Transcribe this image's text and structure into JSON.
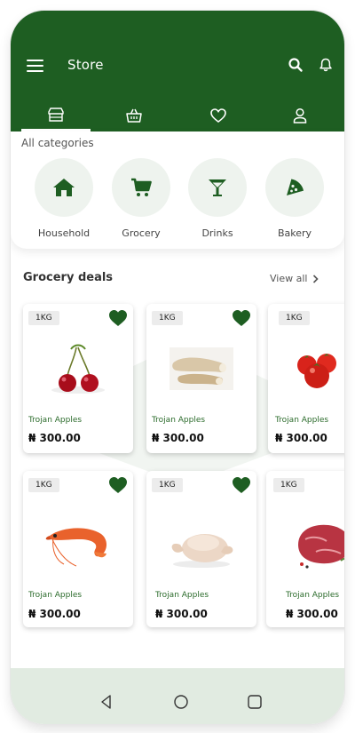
{
  "header": {
    "title": "Store"
  },
  "tabs": [
    {
      "name": "store"
    },
    {
      "name": "basket"
    },
    {
      "name": "favorites"
    },
    {
      "name": "profile"
    }
  ],
  "categories": {
    "heading": "All categories",
    "items": [
      {
        "label": "Household",
        "icon": "home-icon"
      },
      {
        "label": "Grocery",
        "icon": "cart-icon"
      },
      {
        "label": "Drinks",
        "icon": "cocktail-icon"
      },
      {
        "label": "Bakery",
        "icon": "pizza-icon"
      }
    ]
  },
  "deals": {
    "title": "Grocery deals",
    "view_all": "View all",
    "products": [
      {
        "qty": "1KG",
        "name": "Trojan Apples",
        "price": "₦ 300.00",
        "image": "cherries",
        "favorited": true
      },
      {
        "qty": "1KG",
        "name": "Trojan Apples",
        "price": "₦ 300.00",
        "image": "yam",
        "favorited": true
      },
      {
        "qty": "1KG",
        "name": "Trojan Apples",
        "price": "₦ 300.00",
        "image": "tomatoes",
        "favorited": false
      },
      {
        "qty": "1KG",
        "name": "Trojan Apples",
        "price": "₦ 300.00",
        "image": "shrimp",
        "favorited": true
      },
      {
        "qty": "1KG",
        "name": "Trojan Apples",
        "price": "₦ 300.00",
        "image": "chicken",
        "favorited": true
      },
      {
        "qty": "1KG",
        "name": "Trojan Apples",
        "price": "₦ 300.00",
        "image": "beef",
        "favorited": false
      }
    ]
  },
  "colors": {
    "brand": "#1e5e22",
    "accent": "#1e5e22",
    "bottom_bar": "#e1ebe1"
  }
}
